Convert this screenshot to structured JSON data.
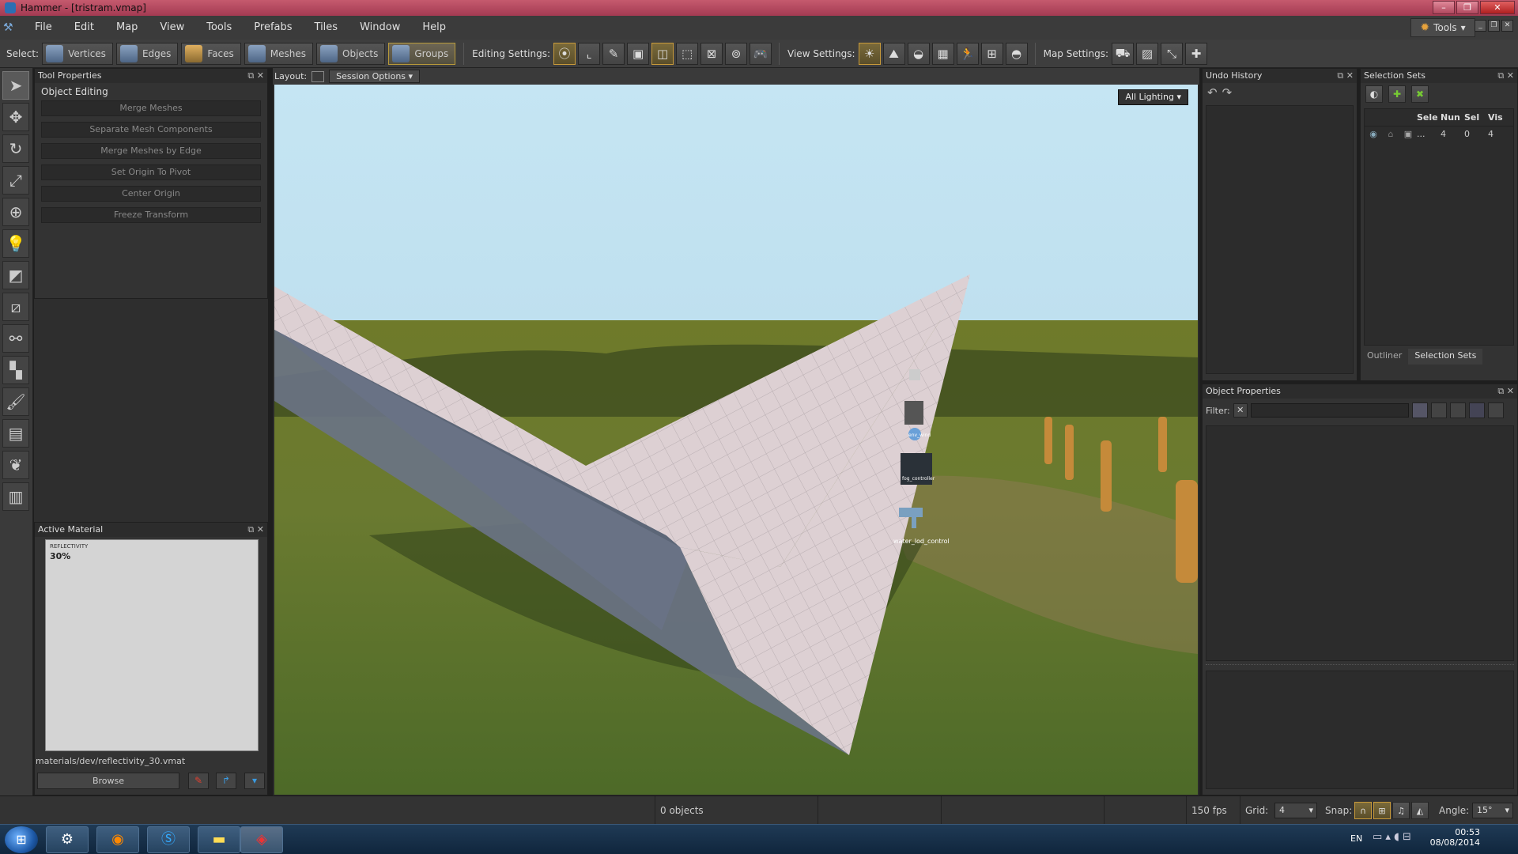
{
  "window": {
    "title": "Hammer - [tristram.vmap]"
  },
  "menu": [
    "File",
    "Edit",
    "Map",
    "View",
    "Tools",
    "Prefabs",
    "Tiles",
    "Window",
    "Help"
  ],
  "tools_button": "Tools",
  "toolbar": {
    "select_label": "Select:",
    "select_modes": [
      {
        "label": "Vertices"
      },
      {
        "label": "Edges"
      },
      {
        "label": "Faces"
      },
      {
        "label": "Meshes"
      },
      {
        "label": "Objects"
      },
      {
        "label": "Groups"
      }
    ],
    "editing_settings_label": "Editing Settings:",
    "view_settings_label": "View Settings:",
    "map_settings_label": "Map Settings:"
  },
  "tool_properties": {
    "header": "Tool Properties",
    "group_title": "Object Editing",
    "buttons": [
      "Merge Meshes",
      "Separate Mesh Components",
      "Merge Meshes by Edge",
      "Set Origin To Pivot",
      "Center Origin",
      "Freeze Transform"
    ]
  },
  "active_material": {
    "header": "Active Material",
    "preview_title": "REFLECTIVITY",
    "preview_value": "30%",
    "path": "materials/dev/reflectivity_30.vmat",
    "browse_label": "Browse"
  },
  "viewport": {
    "layout_label": "Layout:",
    "session_options": "Session Options",
    "lighting_mode": "All Lighting",
    "entity_labels": [
      "env_wind",
      "fog_controller",
      "water_lod_control"
    ]
  },
  "undo_history": {
    "header": "Undo History"
  },
  "selection_sets": {
    "header": "Selection Sets",
    "columns": [
      "Sele",
      "Nun",
      "Sel",
      "Vis"
    ],
    "rows": [
      {
        "name": "...",
        "num": "4",
        "sel": "0",
        "vis": "4"
      }
    ],
    "tabs": [
      "Outliner",
      "Selection Sets"
    ]
  },
  "object_properties": {
    "header": "Object Properties",
    "filter_label": "Filter:"
  },
  "status": {
    "objects": "0 objects",
    "fps": "150 fps",
    "grid_label": "Grid:",
    "grid_value": "4",
    "snap_label": "Snap:",
    "angle_label": "Angle:",
    "angle_value": "15°"
  },
  "taskbar": {
    "lang": "EN",
    "time": "00:53",
    "date": "08/08/2014"
  }
}
